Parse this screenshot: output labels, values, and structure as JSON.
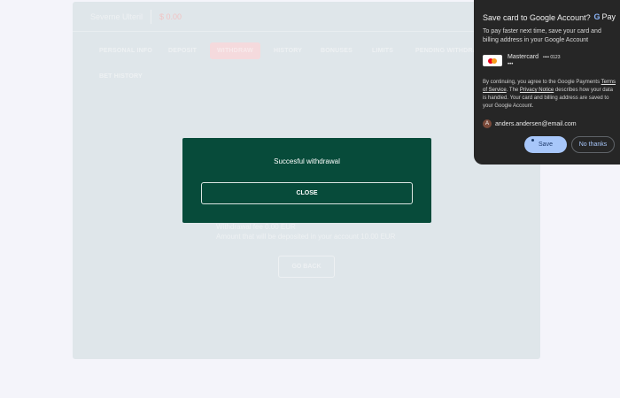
{
  "header": {
    "account_name": "Severne Ulteril",
    "balance": "$ 0.00"
  },
  "tabs": [
    {
      "label": "PERSONAL INFO"
    },
    {
      "label": "DEPOSIT"
    },
    {
      "label": "WITHDRAW",
      "active": true
    },
    {
      "label": "HISTORY"
    },
    {
      "label": "BONUSES"
    },
    {
      "label": "LIMITS"
    },
    {
      "label": "PENDING WITHDRAWALS"
    },
    {
      "label": "BET HISTORY"
    }
  ],
  "withdraw_info": {
    "fee": "Withdrawal fee 0.00 EUR",
    "deposit_amount": "Amount that will be deposited in your account 10.00 EUR",
    "go_back": "GO BACK"
  },
  "modal": {
    "message": "Succesful withdrawal",
    "close_label": "CLOSE"
  },
  "gpay": {
    "title": "Save card to Google Account?",
    "logo_text": "Pay",
    "description": "To pay faster next time, save your card and billing address in your Google Account",
    "card": {
      "brand": "Mastercard",
      "number": "•••• 0123",
      "expiry": "•••"
    },
    "legal": {
      "prefix": "By continuing, you agree to the Google Payments",
      "terms_link": "Terms of Service",
      "middle": ". The ",
      "privacy_link": "Privacy Notice",
      "suffix": " describes how your data is handled. Your card and billing address are saved to your Google Account."
    },
    "account": {
      "initial": "A",
      "email": "anders.andersen@email.com"
    },
    "save_label": "Save",
    "no_thanks_label": "No thanks"
  },
  "colors": {
    "modal_bg": "#074b3a",
    "popup_bg": "#262626",
    "save_button": "#a8c7fa",
    "active_tab": "#f5dadd"
  }
}
